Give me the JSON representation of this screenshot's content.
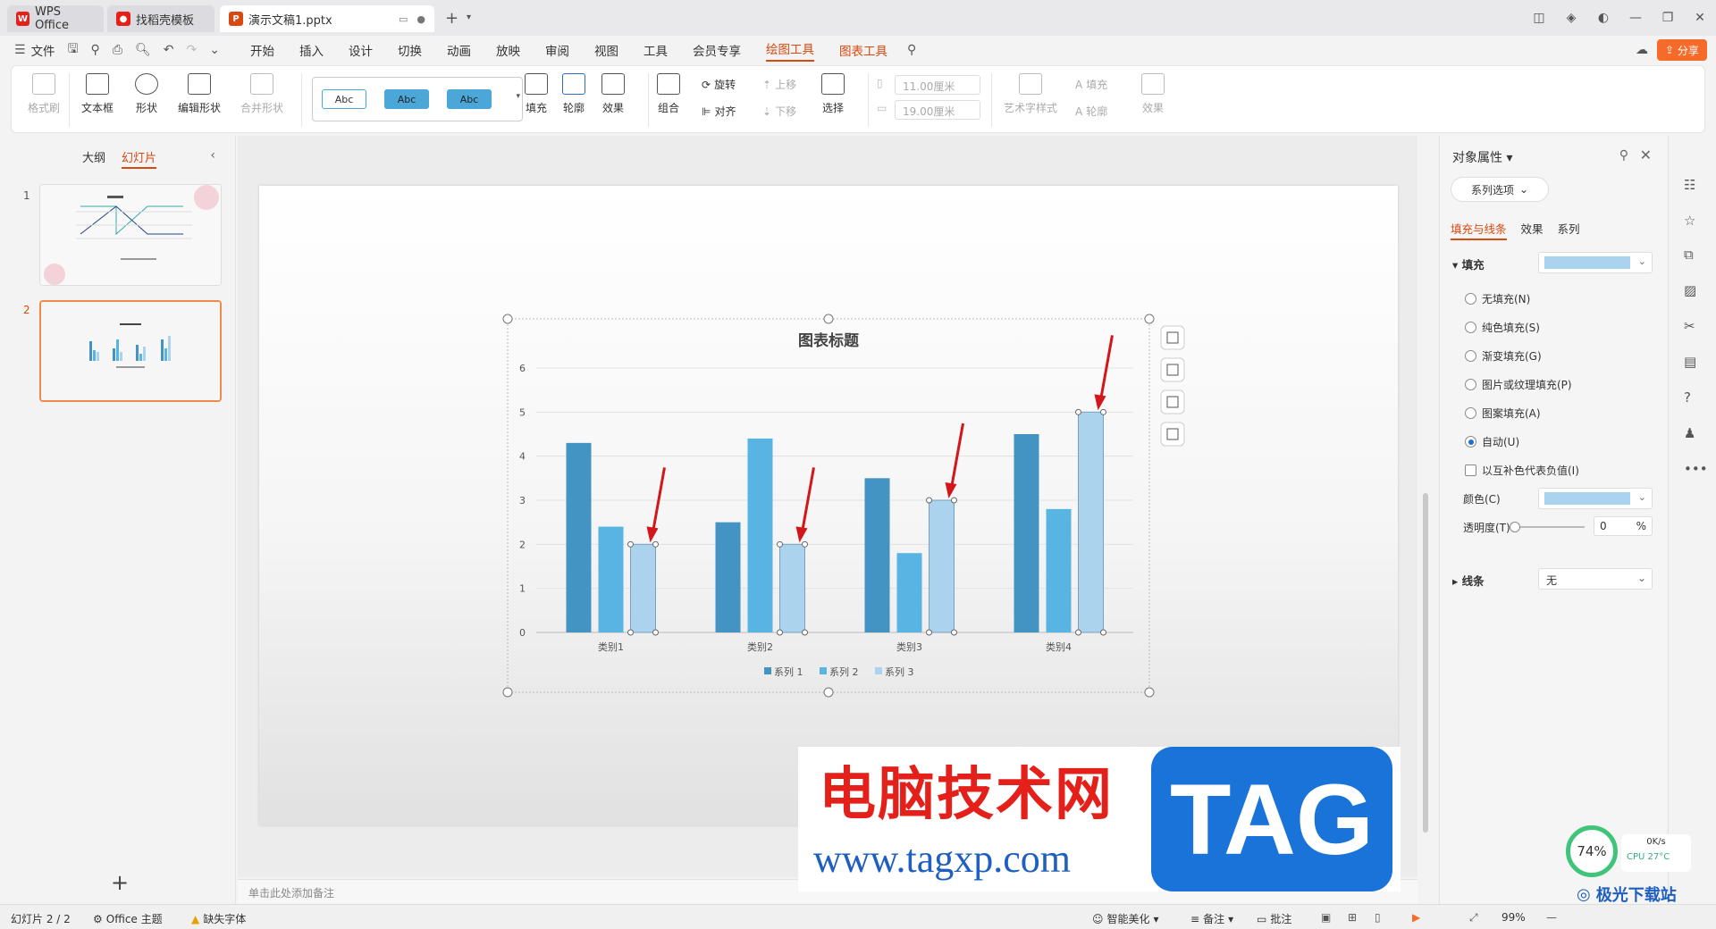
{
  "tabs": {
    "wps": "WPS Office",
    "template": "找稻壳模板",
    "document": "演示文稿1.pptx",
    "add": "+"
  },
  "menu": {
    "file": "文件",
    "items": [
      "开始",
      "插入",
      "设计",
      "切换",
      "动画",
      "放映",
      "审阅",
      "视图",
      "工具",
      "会员专享",
      "绘图工具",
      "图表工具"
    ],
    "active": "绘图工具",
    "share": "分享"
  },
  "ribbon": {
    "format_painter": "格式刷",
    "textbox": "文本框",
    "shape": "形状",
    "edit_shape": "编辑形状",
    "merge_shape": "合并形状",
    "style_samples": [
      "Abc",
      "Abc",
      "Abc"
    ],
    "fill": "填充",
    "outline": "轮廓",
    "effect": "效果",
    "group": "组合",
    "rotate": "旋转",
    "align": "对齐",
    "move_up": "上移",
    "move_down": "下移",
    "select": "选择",
    "height": "11.00厘米",
    "width": "19.00厘米",
    "art_style": "艺术字样式",
    "text_fill": "填充",
    "text_outline": "轮廓",
    "text_effect": "效果"
  },
  "left_panel": {
    "tab_outline": "大纲",
    "tab_slides": "幻灯片",
    "slide_numbers": [
      "1",
      "2"
    ],
    "add": "+"
  },
  "chart_data": {
    "type": "bar",
    "title": "图表标题",
    "categories": [
      "类别1",
      "类别2",
      "类别3",
      "类别4"
    ],
    "series": [
      {
        "name": "系列 1",
        "values": [
          4.3,
          2.5,
          3.5,
          4.5
        ],
        "color": "#4393c3"
      },
      {
        "name": "系列 2",
        "values": [
          2.4,
          4.4,
          1.8,
          2.8
        ],
        "color": "#58b5e3"
      },
      {
        "name": "系列 3",
        "values": [
          2.0,
          2.0,
          3.0,
          5.0
        ],
        "color": "#acd3ee"
      }
    ],
    "y_ticks": [
      "0",
      "1",
      "2",
      "3",
      "4",
      "5",
      "6"
    ],
    "ylim": [
      0,
      6
    ],
    "legend": "bottom",
    "grid": true,
    "selected_series": "系列 3"
  },
  "notes_placeholder": "单击此处添加备注",
  "properties": {
    "title": "对象属性",
    "series_options": "系列选项",
    "tab_fill_line": "填充与线条",
    "tab_effect": "效果",
    "tab_series": "系列",
    "fill_section": "填充",
    "fill_color": "#a9d3ef",
    "options": [
      "无填充(N)",
      "纯色填充(S)",
      "渐变填充(G)",
      "图片或纹理填充(P)",
      "图案填充(A)",
      "自动(U)"
    ],
    "selected_option": "自动(U)",
    "invert_negative": "以互补色代表负值(I)",
    "color_label": "颜色(C)",
    "transparency_label": "透明度(T)",
    "transparency_value": "0",
    "transparency_unit": "%",
    "line_section": "线条",
    "line_value": "无"
  },
  "statusbar": {
    "slide": "幻灯片 2 / 2",
    "theme": "Office 主题",
    "missing_font": "缺失字体",
    "beautify": "智能美化",
    "notes": "备注",
    "comments": "批注",
    "zoom": "99%"
  },
  "watermarks": {
    "site_cn": "电脑技术网",
    "site_url": "www.tagxp.com",
    "tag": "TAG",
    "net_percent": "74%",
    "net_speed": "0K/s",
    "cpu": "CPU 27°C",
    "brand": "极光下载站"
  }
}
